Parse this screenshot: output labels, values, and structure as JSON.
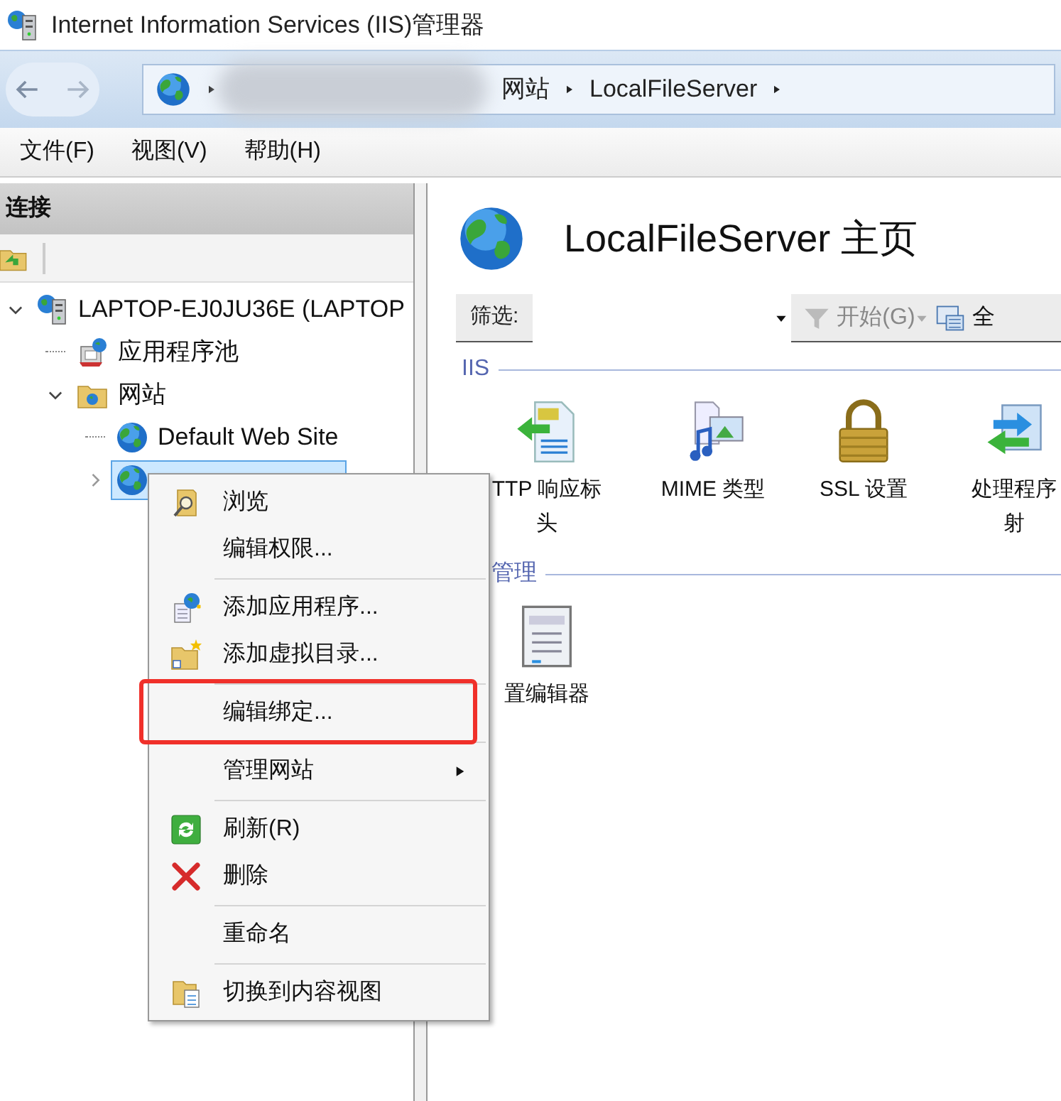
{
  "window": {
    "title": "Internet Information Services (IIS)管理器"
  },
  "address_bar": {
    "breadcrumbs": [
      "网站",
      "LocalFileServer"
    ]
  },
  "menu_bar": [
    "文件(F)",
    "视图(V)",
    "帮助(H)"
  ],
  "connections": {
    "title": "连接",
    "tree": [
      {
        "label": "LAPTOP-EJ0JU36E (LAPTOP",
        "kind": "server",
        "expanded": true,
        "selected": false,
        "children": [
          {
            "label": "应用程序池",
            "kind": "pool",
            "selected": false
          },
          {
            "label": "网站",
            "kind": "folder",
            "expanded": true,
            "selected": false,
            "children": [
              {
                "label": "Default Web Site",
                "kind": "site",
                "selected": false
              },
              {
                "kind": "site",
                "expanded": false,
                "selected": true
              }
            ]
          }
        ]
      }
    ]
  },
  "home": {
    "title": "LocalFileServer 主页",
    "filter": {
      "label": "筛选:",
      "go": "开始(G)",
      "go_disabled": true,
      "show_all": "全"
    },
    "groups": [
      {
        "title": "IIS",
        "features": [
          {
            "lines": [
              "TTP 响应标",
              "头"
            ]
          },
          {
            "lines": [
              "MIME 类型"
            ]
          },
          {
            "lines": [
              "SSL 设置"
            ]
          },
          {
            "lines": [
              "处理程序",
              "射"
            ]
          }
        ]
      },
      {
        "title": "管理",
        "features": [
          {
            "lines": [
              "置编辑器"
            ]
          }
        ]
      }
    ]
  },
  "context_menu": [
    {
      "kind": "item",
      "label": "浏览",
      "highlighted": false,
      "submenu": false
    },
    {
      "kind": "item",
      "label": "编辑权限...",
      "highlighted": false,
      "submenu": false
    },
    {
      "kind": "separator"
    },
    {
      "kind": "item",
      "label": "添加应用程序...",
      "highlighted": false,
      "submenu": false
    },
    {
      "kind": "item",
      "label": "添加虚拟目录...",
      "highlighted": false,
      "submenu": false
    },
    {
      "kind": "separator"
    },
    {
      "kind": "item",
      "label": "编辑绑定...",
      "highlighted": true,
      "submenu": false
    },
    {
      "kind": "separator"
    },
    {
      "kind": "item",
      "label": "管理网站",
      "highlighted": false,
      "submenu": true
    },
    {
      "kind": "separator"
    },
    {
      "kind": "item",
      "label": "刷新(R)",
      "highlighted": false,
      "submenu": false
    },
    {
      "kind": "item",
      "label": "删除",
      "highlighted": false,
      "submenu": false
    },
    {
      "kind": "separator"
    },
    {
      "kind": "item",
      "label": "重命名",
      "highlighted": false,
      "submenu": false
    },
    {
      "kind": "separator"
    },
    {
      "kind": "item",
      "label": "切换到内容视图",
      "highlighted": false,
      "submenu": false
    }
  ]
}
